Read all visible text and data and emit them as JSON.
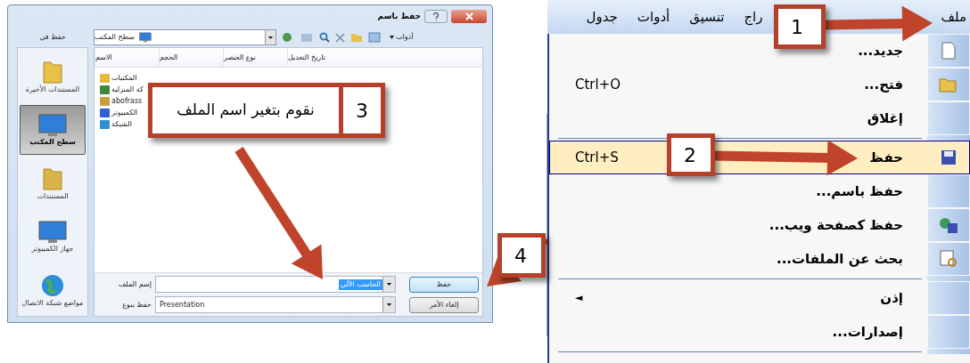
{
  "save_dialog": {
    "title": "حفظ باسم",
    "save_in_label": "حفظ في",
    "location": "سطح المكتب",
    "tools_menu": "أدوات",
    "places": [
      {
        "label": "المستندات الأخيرة",
        "selected": false
      },
      {
        "label": "سطح المكتب",
        "selected": true
      },
      {
        "label": "المستندات",
        "selected": false
      },
      {
        "label": "جهاز الكمبيوتر",
        "selected": false
      },
      {
        "label": "مواضع شبكة الاتصال",
        "selected": false
      }
    ],
    "columns": [
      "تاريخ التعديل",
      "نوع العنصر",
      "الحجم",
      "الاسم"
    ],
    "files": [
      {
        "name": "المكتبات"
      },
      {
        "name": "كة المنزلية"
      },
      {
        "name": "abofrass"
      },
      {
        "name": "الكمبيوتر"
      },
      {
        "name": "الشبكة"
      }
    ],
    "file_name_label": "إسم الملف",
    "file_name": "الحاسب الآلي",
    "file_type_label": "حفظ بنوع",
    "file_type": "Presentation",
    "buttons": [
      "حفظ",
      "إلغاء الأمر"
    ]
  },
  "menu_bar": [
    "ملف",
    "راج",
    "تنسيق",
    "أدوات",
    "جدول"
  ],
  "file_menu": [
    {
      "kind": "item",
      "label": "جديد...",
      "highlighted": false
    },
    {
      "kind": "item",
      "label": "فتح...",
      "shortcut": "Ctrl+O",
      "highlighted": false
    },
    {
      "kind": "item",
      "label": "إغلاق",
      "highlighted": false
    },
    {
      "kind": "separator"
    },
    {
      "kind": "item",
      "label": "حفظ",
      "shortcut": "Ctrl+S",
      "highlighted": true
    },
    {
      "kind": "item",
      "label": "حفظ باسم...",
      "highlighted": false
    },
    {
      "kind": "item",
      "label": "حفظ كصفحة ويب...",
      "highlighted": false
    },
    {
      "kind": "item",
      "label": "بحث عن الملفات...",
      "highlighted": false
    },
    {
      "kind": "separator"
    },
    {
      "kind": "submenu",
      "label": "إذن",
      "arrow": "◄",
      "highlighted": false
    },
    {
      "kind": "item",
      "label": "إصدارات...",
      "highlighted": false
    },
    {
      "kind": "separator"
    }
  ],
  "callouts": [
    {
      "number": "1"
    },
    {
      "number": "2"
    },
    {
      "number": "3",
      "text": "نقوم بتغير اسم الملف"
    },
    {
      "number": "4"
    }
  ]
}
